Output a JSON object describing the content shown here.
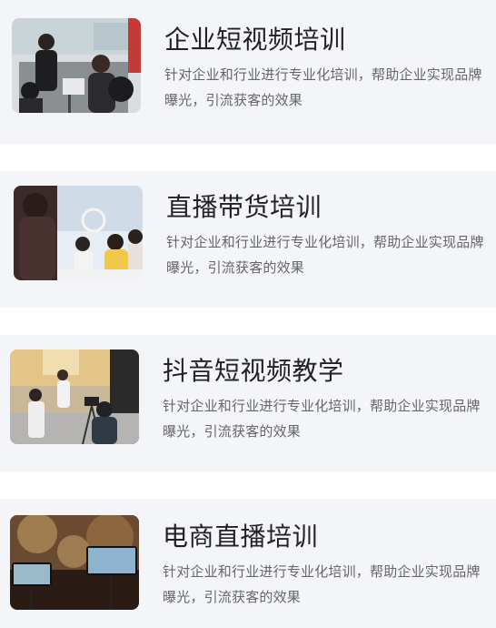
{
  "services": [
    {
      "title": "企业短视频培训",
      "description": "针对企业和行业进行专业化培训，帮助企业实现品牌曝光，引流获客的效果",
      "image": "team-filming-photo"
    },
    {
      "title": "直播带货培训",
      "description": "针对企业和行业进行专业化培训，帮助企业实现品牌曝光，引流获客的效果",
      "image": "livestream-class-photo"
    },
    {
      "title": "抖音短视频教学",
      "description": "针对企业和行业进行专业化培训，帮助企业实现品牌曝光，引流获客的效果",
      "image": "video-shooting-studio-photo"
    },
    {
      "title": "电商直播培训",
      "description": "针对企业和行业进行专业化培训，帮助企业实现品牌曝光，引流获客的效果",
      "image": "phone-livestream-rig-photo"
    }
  ]
}
